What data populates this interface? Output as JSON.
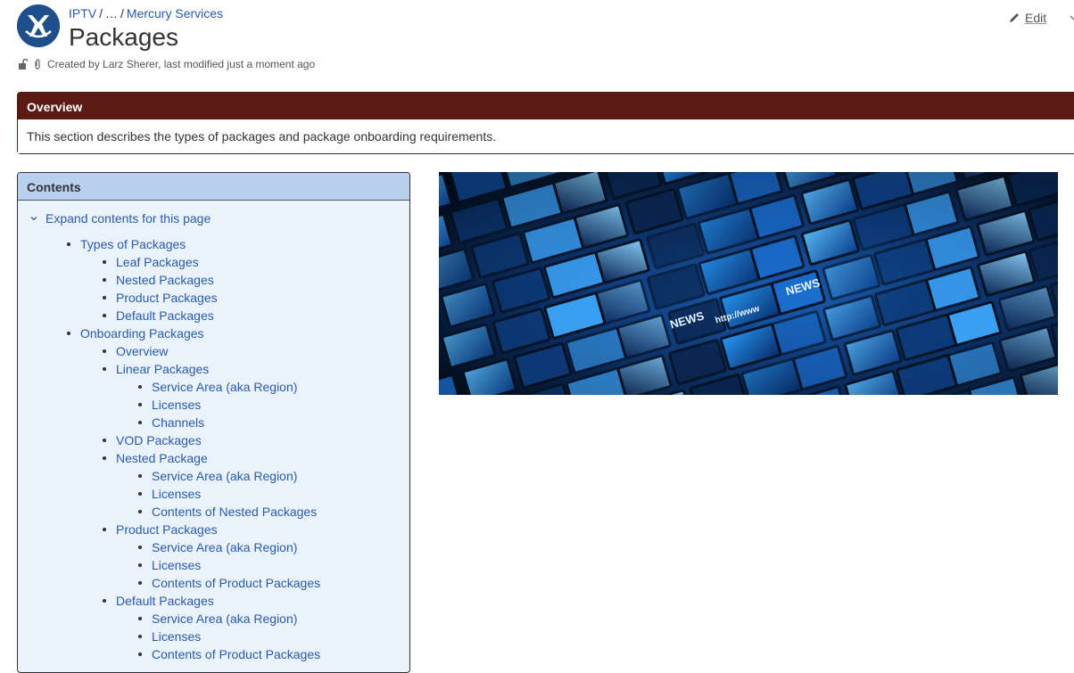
{
  "breadcrumbs": [
    "IPTV",
    "…",
    "Mercury Services"
  ],
  "page": {
    "title": "Packages",
    "meta": "Created by Larz Sherer, last modified just a moment ago"
  },
  "toolbar": {
    "edit_label": "Edit"
  },
  "overview": {
    "title": "Overview",
    "text": "This section describes the types of packages and package onboarding requirements."
  },
  "contents": {
    "title": "Contents",
    "expand_label": "Expand contents for this page",
    "items": [
      {
        "label": "Types of Packages",
        "level": 1
      },
      {
        "label": "Leaf Packages",
        "level": 2
      },
      {
        "label": "Nested Packages",
        "level": 2
      },
      {
        "label": "Product Packages",
        "level": 2
      },
      {
        "label": "Default Packages",
        "level": 2
      },
      {
        "label": "Onboarding Packages",
        "level": 1
      },
      {
        "label": "Overview",
        "level": 2
      },
      {
        "label": "Linear Packages",
        "level": 2
      },
      {
        "label": "Service Area (aka Region)",
        "level": 3
      },
      {
        "label": "Licenses",
        "level": 3
      },
      {
        "label": "Channels",
        "level": 3
      },
      {
        "label": "VOD Packages",
        "level": 2
      },
      {
        "label": "Nested Package",
        "level": 2
      },
      {
        "label": "Service Area (aka Region)",
        "level": 3
      },
      {
        "label": "Licenses",
        "level": 3
      },
      {
        "label": "Contents of Nested Packages",
        "level": 3
      },
      {
        "label": "Product Packages",
        "level": 2
      },
      {
        "label": "Service Area (aka Region)",
        "level": 3
      },
      {
        "label": "Licenses",
        "level": 3
      },
      {
        "label": "Contents of Product Packages",
        "level": 3
      },
      {
        "label": "Default Packages",
        "level": 2
      },
      {
        "label": "Service Area (aka Region)",
        "level": 3
      },
      {
        "label": "Licenses",
        "level": 3
      },
      {
        "label": "Contents of Product Packages",
        "level": 3
      }
    ]
  },
  "banner": {
    "tile_words": [
      "NEWS",
      "http://www",
      "NEWS"
    ]
  },
  "colors": {
    "overview_header": "#5b1a14",
    "contents_header": "#b9d1ee",
    "contents_bg": "#eaf3fc",
    "link": "#2a5ba8"
  },
  "icons": {
    "space_logo": "space-logo",
    "restrictions": "unlock-icon",
    "attachments": "paperclip-icon",
    "edit": "pencil-icon",
    "expand": "chevron-down-icon"
  }
}
